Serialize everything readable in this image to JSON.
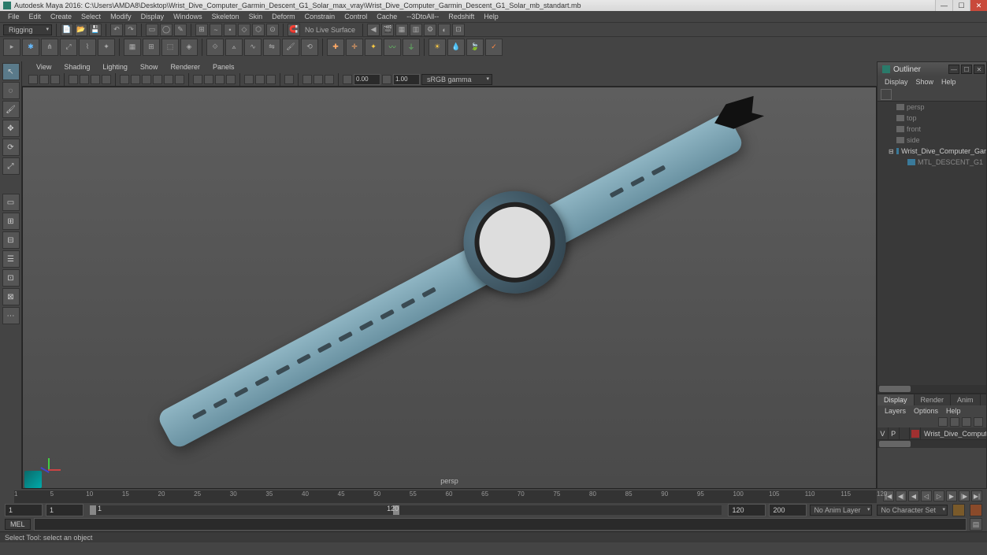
{
  "title": "Autodesk Maya 2016: C:\\Users\\AMDA8\\Desktop\\Wrist_Dive_Computer_Garmin_Descent_G1_Solar_max_vray\\Wrist_Dive_Computer_Garmin_Descent_G1_Solar_mb_standart.mb",
  "menubar": [
    "File",
    "Edit",
    "Create",
    "Select",
    "Modify",
    "Display",
    "Windows",
    "Skeleton",
    "Skin",
    "Deform",
    "Constrain",
    "Control",
    "Cache",
    "--3DtoAll--",
    "Redshift",
    "Help"
  ],
  "shelf_mode": "Rigging",
  "no_live": "No Live Surface",
  "vp_menu": [
    "View",
    "Shading",
    "Lighting",
    "Show",
    "Renderer",
    "Panels"
  ],
  "vp_numA": "0.00",
  "vp_numB": "1.00",
  "vp_gamma": "sRGB gamma",
  "persp": "persp",
  "outliner": {
    "title": "Outliner",
    "menu": [
      "Display",
      "Show",
      "Help"
    ],
    "items": [
      {
        "label": "persp",
        "icon": "cam",
        "indent": 24
      },
      {
        "label": "top",
        "icon": "cam",
        "indent": 24
      },
      {
        "label": "front",
        "icon": "cam",
        "indent": 24
      },
      {
        "label": "side",
        "icon": "cam",
        "indent": 24
      },
      {
        "label": "Wrist_Dive_Computer_Gar",
        "icon": "mesh",
        "indent": 14,
        "exp": "⊟",
        "sel": true
      },
      {
        "label": "MTL_DESCENT_G1",
        "icon": "mesh",
        "indent": 38
      }
    ]
  },
  "layers": {
    "tabs": [
      "Display",
      "Render",
      "Anim"
    ],
    "menu": [
      "Layers",
      "Options",
      "Help"
    ],
    "row": {
      "v": "V",
      "p": "P",
      "name": "Wrist_Dive_Computer_"
    }
  },
  "timeline": {
    "ticks": [
      1,
      5,
      10,
      15,
      20,
      25,
      30,
      35,
      40,
      45,
      50,
      55,
      60,
      65,
      70,
      75,
      80,
      85,
      90,
      95,
      100,
      105,
      110,
      115,
      120
    ],
    "start_outer": "1",
    "start_inner": "1",
    "cur": "1",
    "mid": "120",
    "end_inner": "120",
    "end_outer": "200",
    "anim_layer": "No Anim Layer",
    "char_set": "No Character Set"
  },
  "cmd_label": "MEL",
  "help_line": "Select Tool: select an object"
}
